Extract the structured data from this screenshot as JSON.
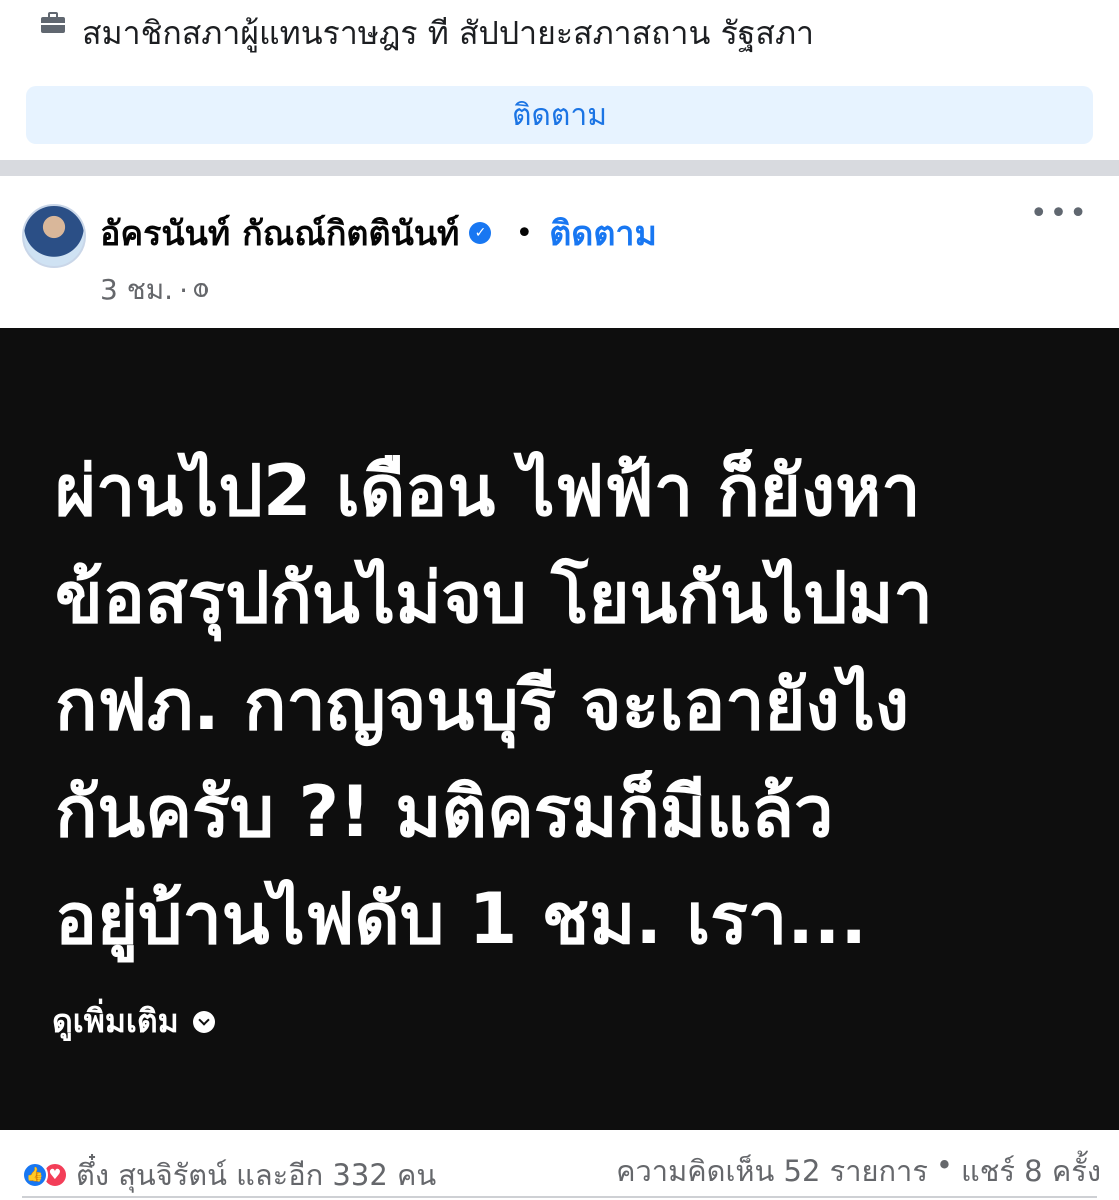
{
  "top_card": {
    "description": "สมาชิกสภาผู้แทนราษฎร ที สัปปายะสภาสถาน รัฐสภา",
    "follow_button": "ติดตาม"
  },
  "post": {
    "author": "อัครนันท์ กัณณ์กิตตินันท์",
    "follow_link": "ติดตาม",
    "time": "3 ชม.",
    "body_lines": [
      "ผ่านไป2 เดือน ไฟฟ้า ก็ยังหา",
      "ข้อสรุปกันไม่จบ โยนกันไปมา",
      "กฟภ. กาญจนบุรี จะเอายังไง",
      "กันครับ  ?!  มติครมก็มีแล้ว",
      "อยู่บ้านไฟดับ 1 ชม. เรา..."
    ],
    "see_more": "ดูเพิ่มเติม"
  },
  "footer": {
    "reactions_text": "ตึ๋ง สุนจิรัตน์ และอีก 332 คน",
    "comments": "ความคิดเห็น 52 รายการ",
    "separator": "•",
    "shares": "แชร์ 8 ครั้ง"
  },
  "icons": {
    "top": "briefcase-icon",
    "verified": "verified-badge-icon",
    "privacy": "globe-icon",
    "more": "more-options-icon",
    "see_more": "chevron-down-icon",
    "reactions": [
      "like-icon",
      "love-icon"
    ]
  },
  "colors": {
    "accent": "#1877f2",
    "post_background": "#0e0e0e",
    "love": "#f33e58"
  }
}
